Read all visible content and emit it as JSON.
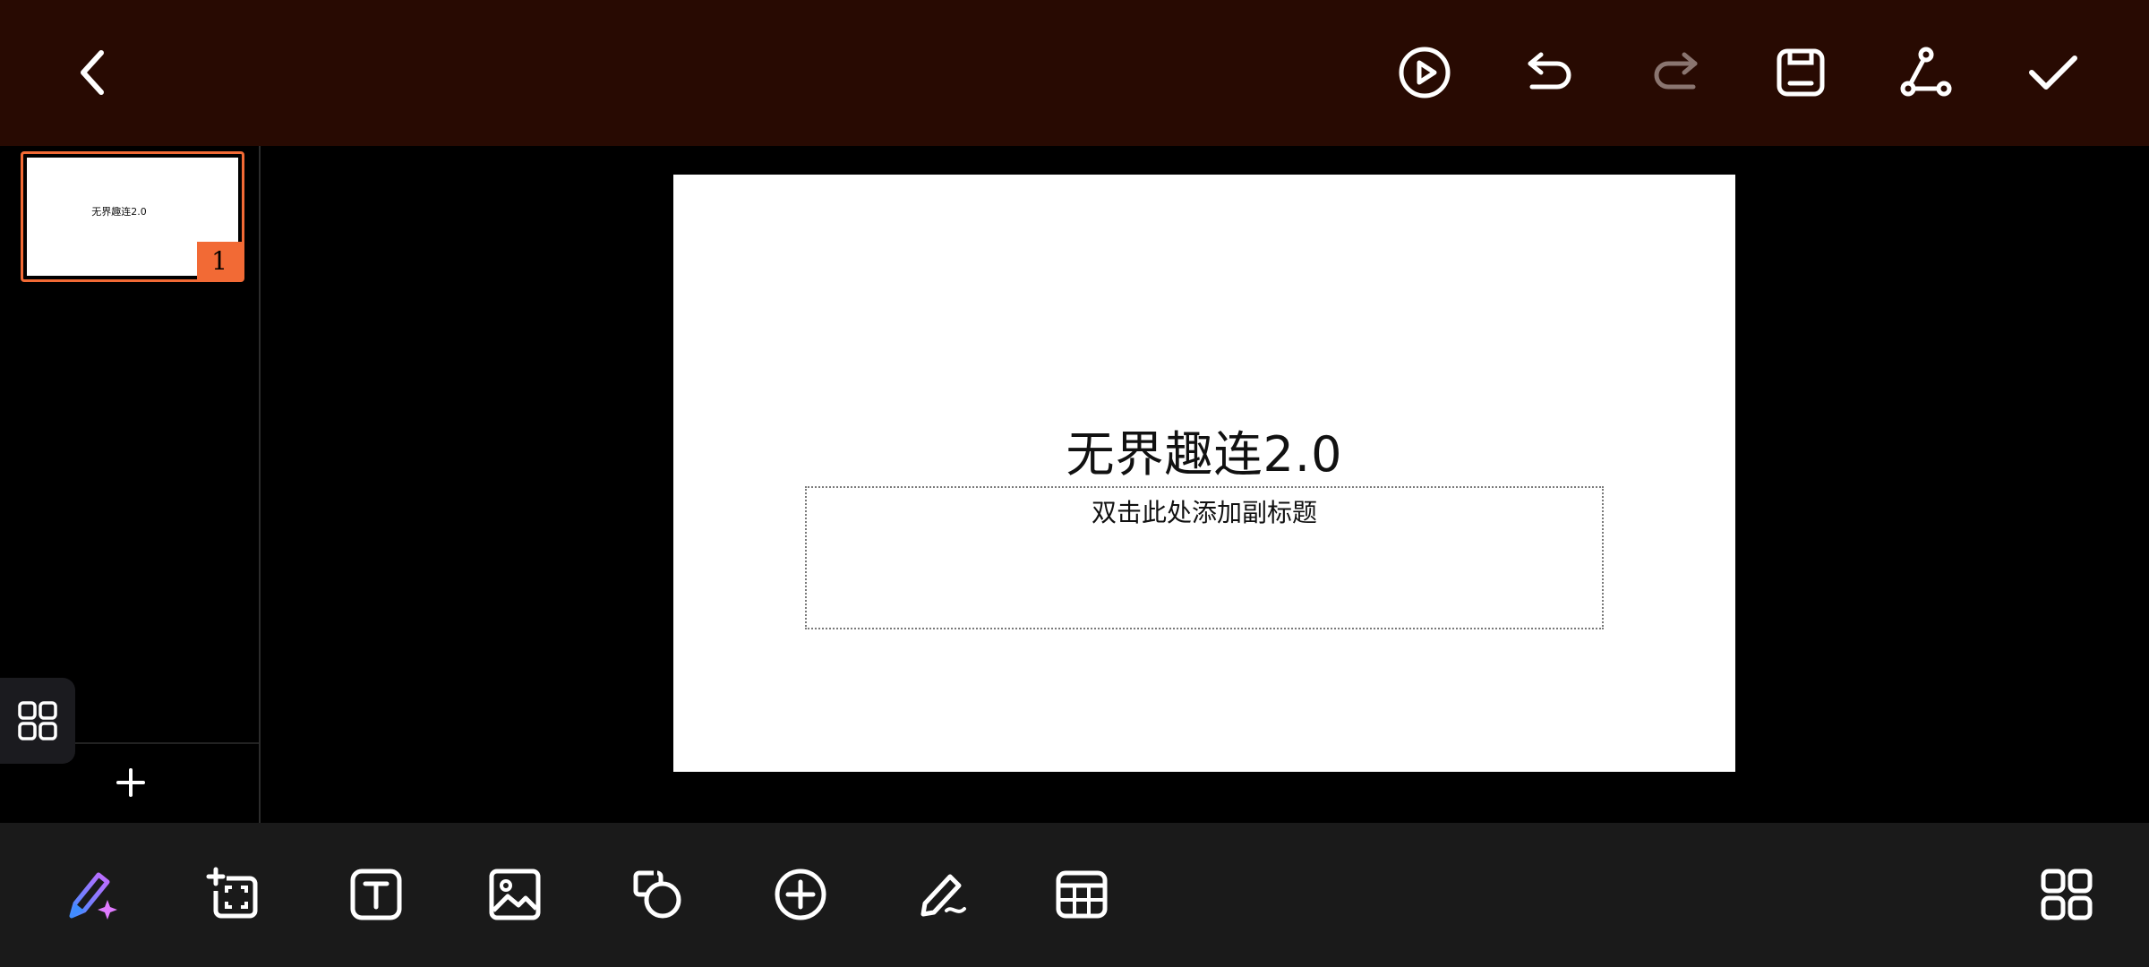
{
  "toolbar_top": {
    "icons": [
      "back-icon",
      "play-icon",
      "undo-icon",
      "redo-icon",
      "save-icon",
      "share-icon",
      "check-icon"
    ],
    "redo_disabled": true
  },
  "slides_panel": {
    "slides": [
      {
        "number": "1",
        "title": "无界趣连2.0"
      }
    ],
    "selected_color": "#f26a35"
  },
  "slide": {
    "title": "无界趣连2.0",
    "subtitle_placeholder": "双击此处添加副标题"
  },
  "toolbar_bottom": {
    "icons": [
      "ai-pen-icon",
      "add-slide-frame-icon",
      "text-box-icon",
      "image-icon",
      "shapes-icon",
      "insert-icon",
      "pen-icon",
      "table-icon",
      "more-grid-icon"
    ]
  },
  "colors": {
    "topbar_bg": "#280a02",
    "canvas_bg": "#000000",
    "bottombar_bg": "#1a1a1a",
    "accent": "#f26a35"
  }
}
